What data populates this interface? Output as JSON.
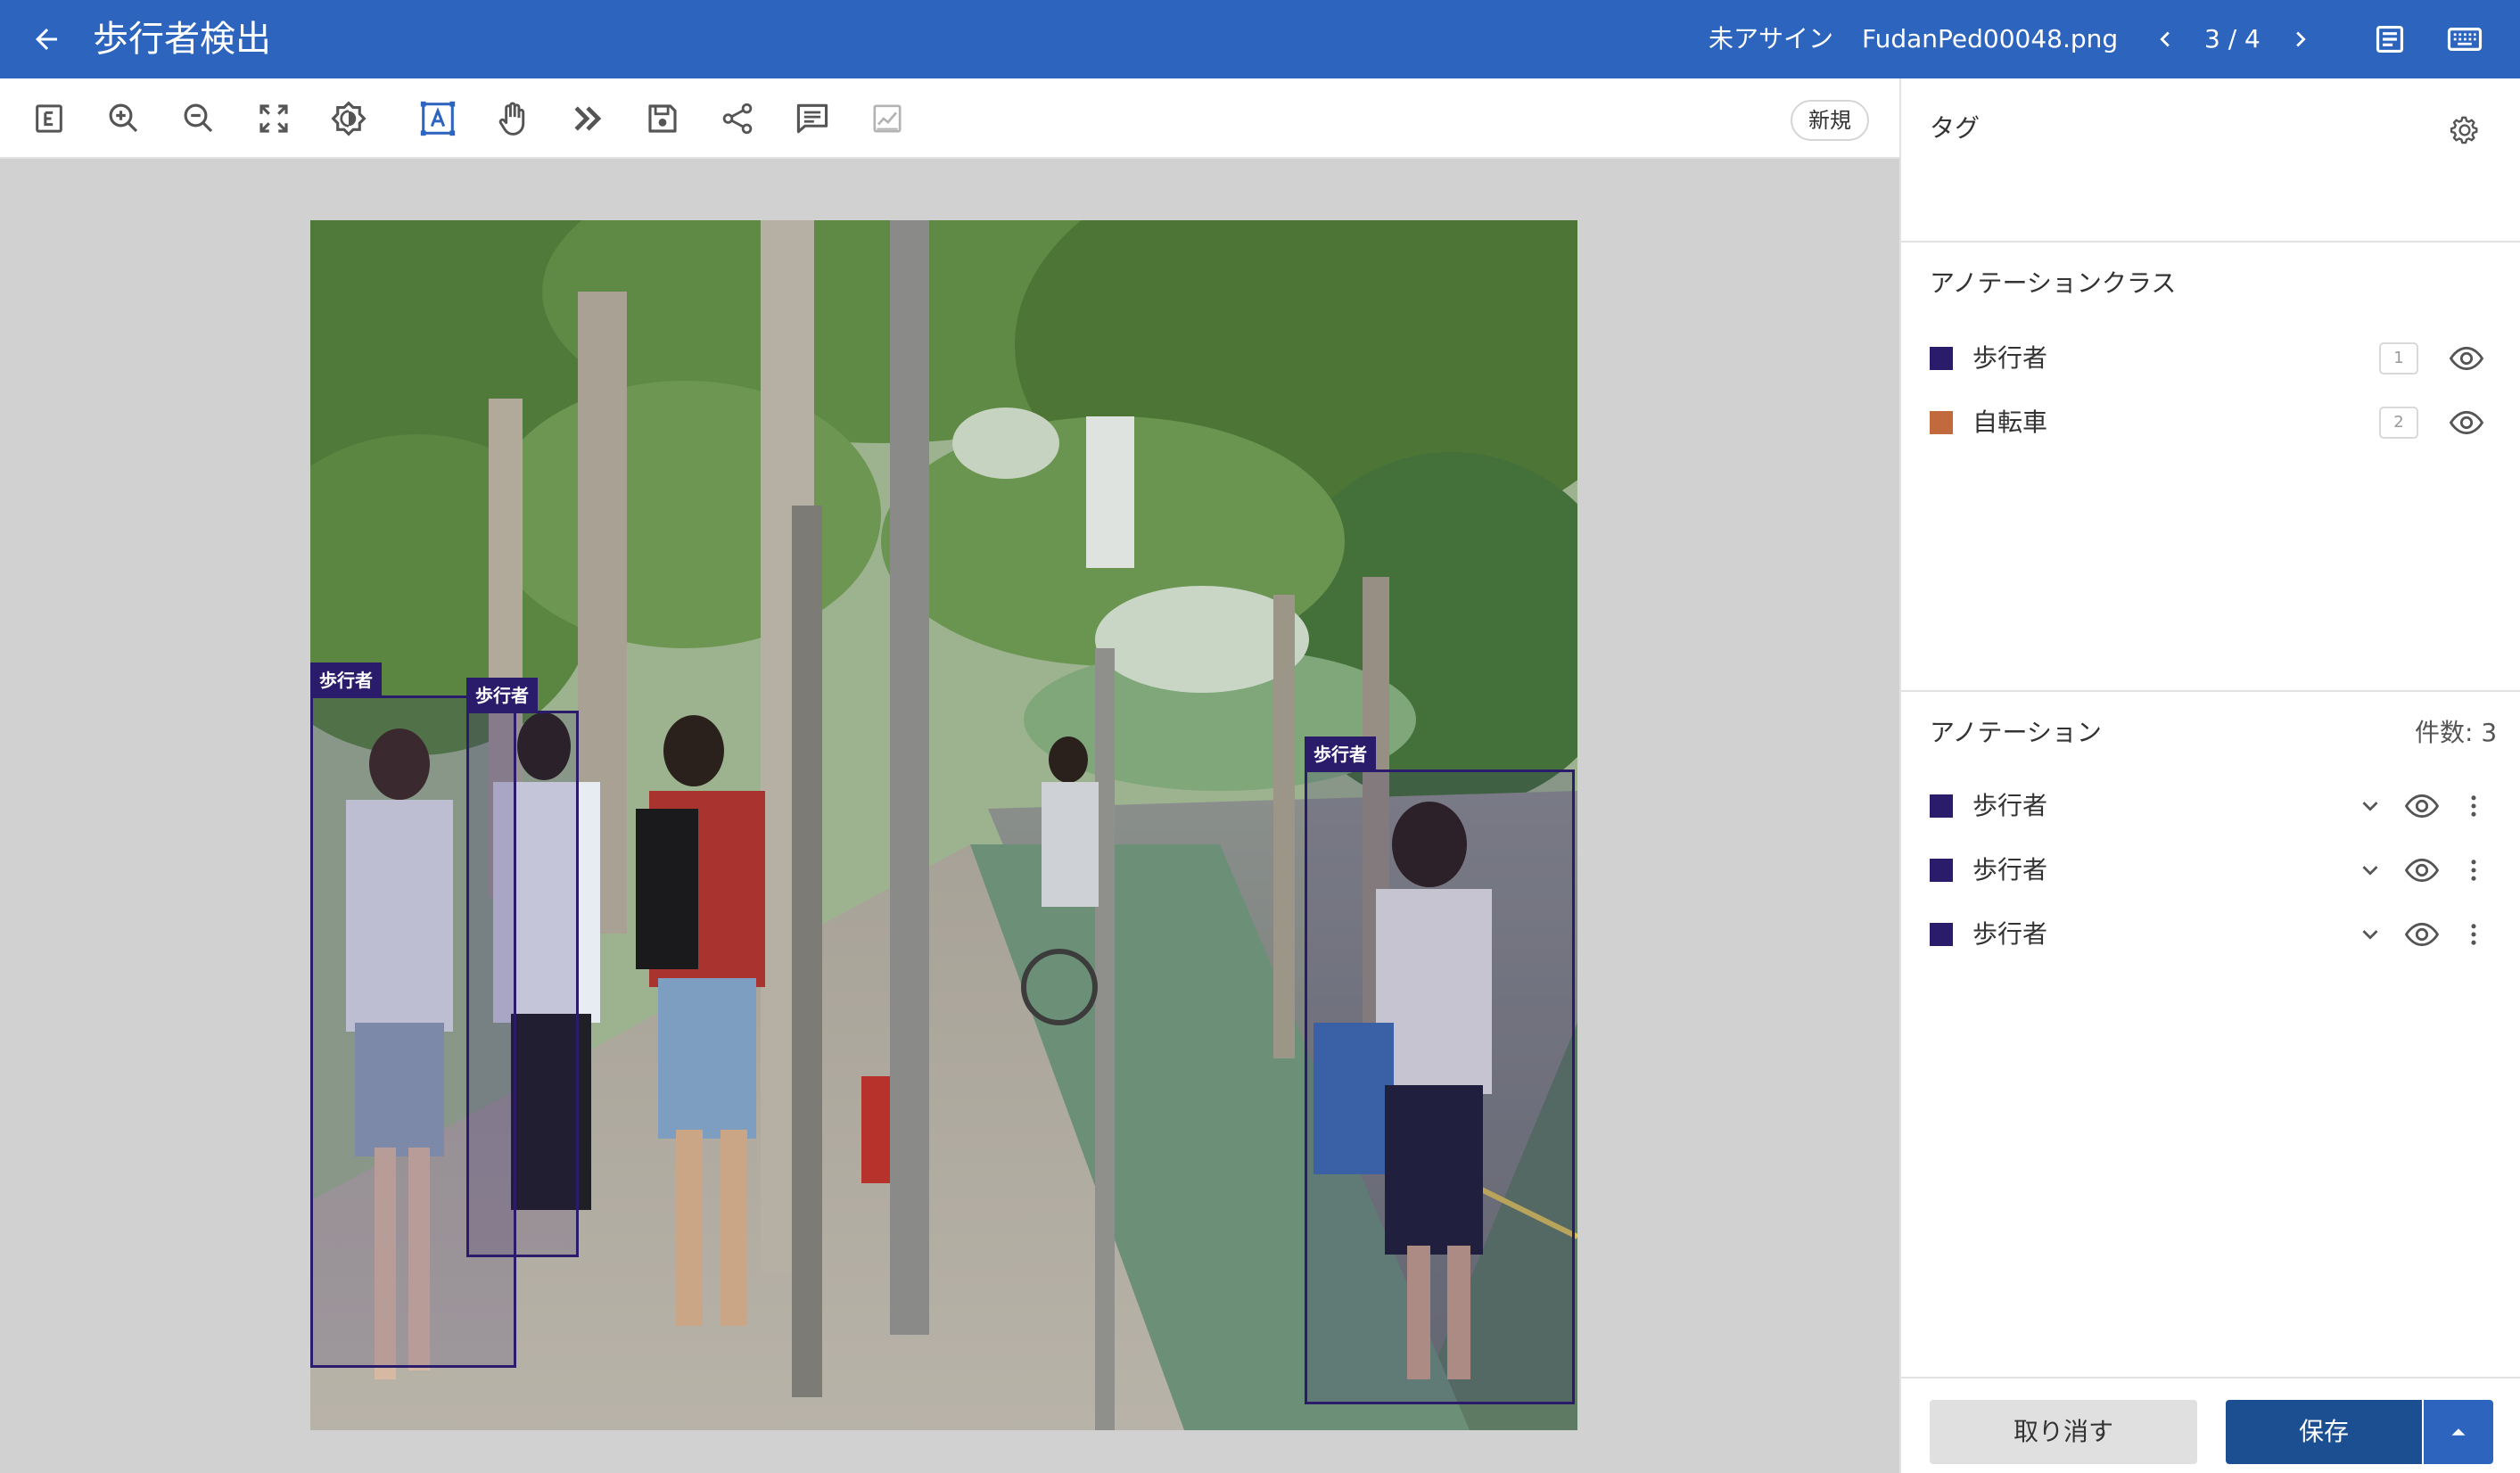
{
  "header": {
    "title": "歩行者検出",
    "status": "未アサイン",
    "file_name": "FudanPed00048.png",
    "pager": "3 / 4"
  },
  "toolbar": {
    "tools": [
      "edit-icon",
      "zoom-in-icon",
      "zoom-out-icon",
      "fit-screen-icon",
      "brightness-icon",
      "text-box-icon",
      "hand-icon",
      "skip-icon",
      "save-icon",
      "share-icon",
      "comment-icon",
      "chart-icon"
    ],
    "new_label": "新規"
  },
  "canvas": {
    "annotations": [
      {
        "label": "歩行者"
      },
      {
        "label": "歩行者"
      },
      {
        "label": "歩行者"
      }
    ]
  },
  "panel": {
    "tags_title": "タグ",
    "classes_title": "アノテーションクラス",
    "classes": [
      {
        "name": "歩行者",
        "hotkey": "1",
        "color": "#2b1c6b"
      },
      {
        "name": "自転車",
        "hotkey": "2",
        "color": "#c26a3e"
      }
    ],
    "annotations_title": "アノテーション",
    "annotations_count": "件数: 3",
    "annotations": [
      {
        "name": "歩行者",
        "color": "#2b1c6b"
      },
      {
        "name": "歩行者",
        "color": "#2b1c6b"
      },
      {
        "name": "歩行者",
        "color": "#2b1c6b"
      }
    ]
  },
  "footer": {
    "cancel_label": "取り消す",
    "save_label": "保存"
  },
  "colors": {
    "header": "#2d65be",
    "primary": "#1b4f91",
    "annotation": "#2b1c6b"
  }
}
